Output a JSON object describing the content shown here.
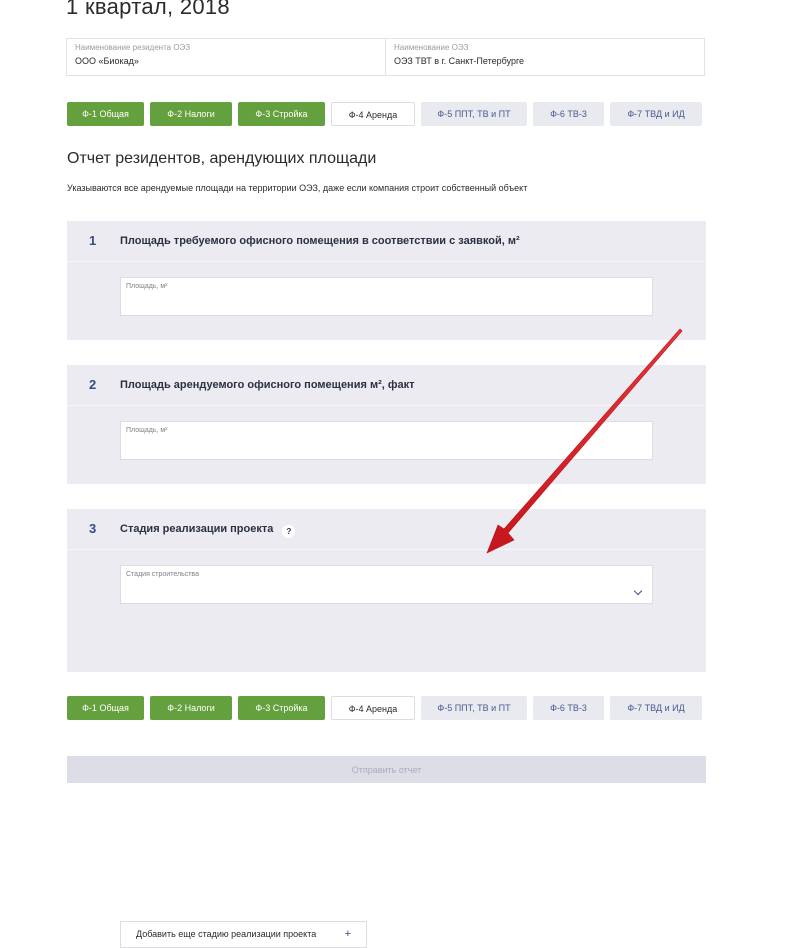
{
  "page": {
    "title": "1 квартал, 2018"
  },
  "resident": {
    "name_caption": "Наименование резидента ОЭЗ",
    "name_value": "ООО «Биокад»",
    "sez_caption": "Наименование ОЭЗ",
    "sez_value": "ОЭЗ ТВТ в г. Санкт-Петербурге"
  },
  "tabs": [
    {
      "label": "Ф-1 Общая",
      "state": "done"
    },
    {
      "label": "Ф-2 Налоги",
      "state": "done"
    },
    {
      "label": "Ф-3 Стройка",
      "state": "done"
    },
    {
      "label": "Ф-4 Аренда",
      "state": "active"
    },
    {
      "label": "Ф-5 ППТ, ТВ и ПТ",
      "state": "todo"
    },
    {
      "label": "Ф-6 ТВ-3",
      "state": "todo"
    },
    {
      "label": "Ф-7 ТВД и ИД",
      "state": "todo"
    }
  ],
  "section": {
    "title": "Отчет резидентов, арендующих площади",
    "note": "Указываются все арендуемые площади на территории ОЭЗ, даже если компания строит собственный объект"
  },
  "questions": [
    {
      "number": "1",
      "label": "Площадь требуемого офисного помещения в соответствии с заявкой, м²",
      "field_caption": "Площадь, м²",
      "field_value": ""
    },
    {
      "number": "2",
      "label": "Площадь арендуемого офисного помещения м², факт",
      "field_caption": "Площадь, м²",
      "field_value": ""
    },
    {
      "number": "3",
      "label": "Стадия реализации проекта",
      "help": "?",
      "field_caption": "Стадия строительства",
      "field_value": ""
    }
  ],
  "add_stage": {
    "label": "Добавить еще стадию реализации проекта",
    "plus": "+"
  },
  "submit": {
    "label": "Отправить отчет"
  },
  "colors": {
    "done_tab": "#64a03e",
    "todo_tab": "#e9eaf0",
    "accent": "#3b4a86",
    "arrow": "#e02327"
  }
}
